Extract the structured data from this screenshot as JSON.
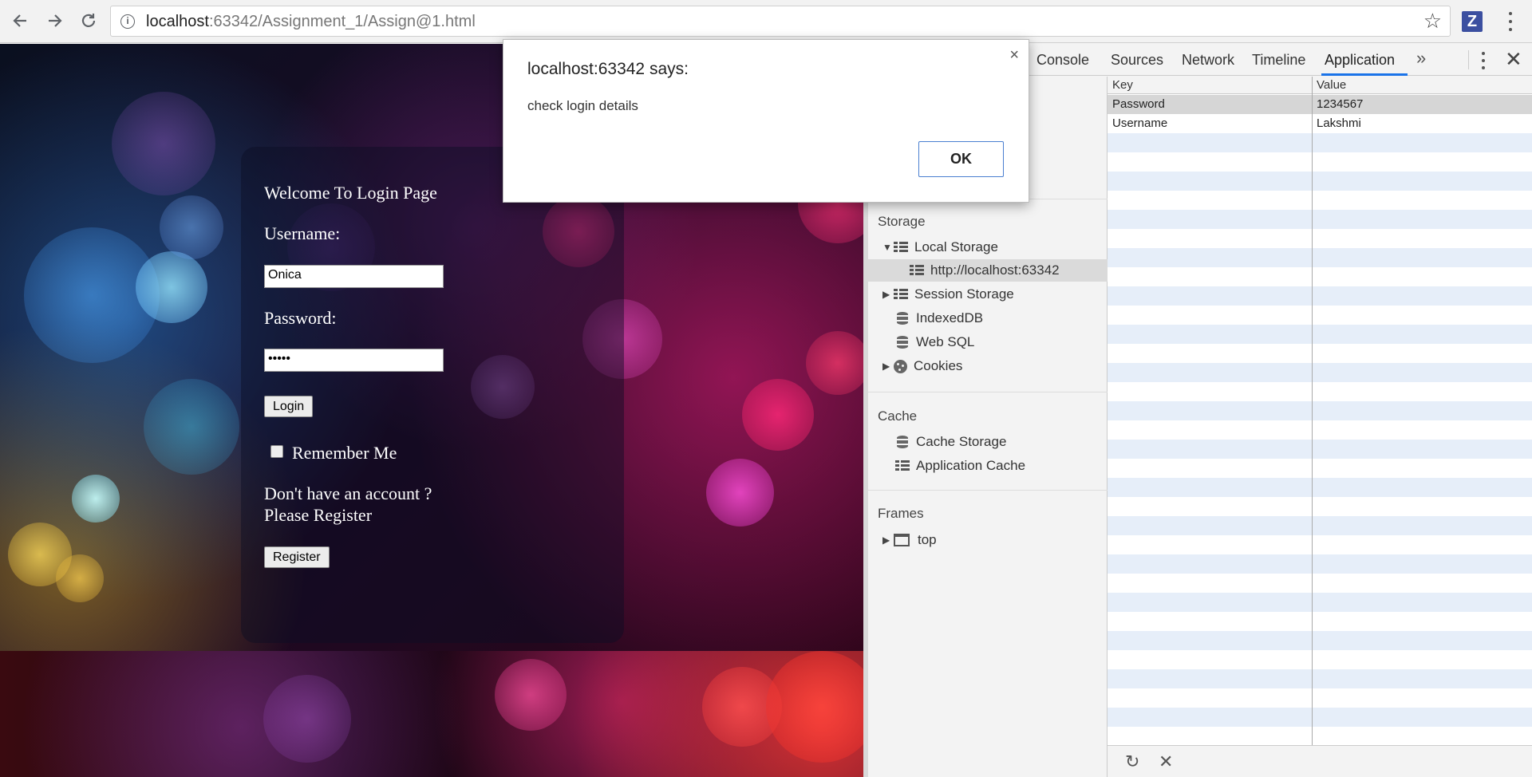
{
  "browser": {
    "url_host": "localhost",
    "url_rest": ":63342/Assignment_1/Assign@1.html",
    "extension_label": "Z",
    "icons": {
      "back": "back-arrow-icon",
      "forward": "forward-arrow-icon",
      "reload": "reload-icon",
      "info": "info-icon",
      "bookmark": "star-icon",
      "menu": "kebab-menu-icon"
    }
  },
  "page": {
    "welcome": "Welcome To Login Page",
    "username_label": "Username:",
    "username_value": "Onica",
    "password_label": "Password:",
    "password_value": "•••••",
    "login_button": "Login",
    "remember_label": "Remember Me",
    "no_account_line1": "Don't have an account ?",
    "no_account_line2": "Please Register",
    "register_button": "Register"
  },
  "dialog": {
    "title": "localhost:63342 says:",
    "message": "check login details",
    "ok_label": "OK",
    "close_glyph": "×"
  },
  "devtools": {
    "tabs": [
      "Console",
      "Sources",
      "Network",
      "Timeline",
      "Application"
    ],
    "active_tab": "Application",
    "more_glyph": "»",
    "close_glyph": "✕",
    "sidebar": {
      "storage_heading": "Storage",
      "local_storage": "Local Storage",
      "local_storage_origin": "http://localhost:63342",
      "session_storage": "Session Storage",
      "indexeddb": "IndexedDB",
      "websql": "Web SQL",
      "cookies": "Cookies",
      "cache_heading": "Cache",
      "cache_storage": "Cache Storage",
      "application_cache": "Application Cache",
      "frames_heading": "Frames",
      "frame_top": "top"
    },
    "table": {
      "columns": [
        "Key",
        "Value"
      ],
      "rows": [
        {
          "key": "Password",
          "value": "1234567"
        },
        {
          "key": "Username",
          "value": "Lakshmi"
        }
      ]
    },
    "footer": {
      "refresh_glyph": "↻",
      "delete_glyph": "✕"
    }
  },
  "colors": {
    "accent": "#1a73e8",
    "row_stripe": "#e6eef9",
    "selected_row": "#d6d6d6"
  }
}
